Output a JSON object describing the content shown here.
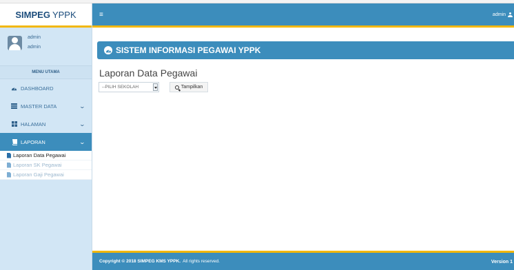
{
  "brand": {
    "bold": "SIMPEG",
    "rest": "YPPK"
  },
  "user_panel": {
    "name": "admin",
    "role": "admin"
  },
  "sidebar": {
    "header": "MENU UTAMA",
    "items": [
      {
        "label": "DASHBOARD",
        "icon": "dashboard-icon"
      },
      {
        "label": "MASTER DATA",
        "icon": "table-icon"
      },
      {
        "label": "HALAMAN",
        "icon": "grid-icon"
      },
      {
        "label": "LAPORAN",
        "icon": "book-icon"
      }
    ],
    "submenu": [
      {
        "label": "Laporan Data Pegawai"
      },
      {
        "label": "Laporan SK Pegawai"
      },
      {
        "label": "Laporan Gaji Pegawai"
      }
    ]
  },
  "navbar": {
    "menu_icon": "≡",
    "user_label": "admin"
  },
  "banner": {
    "title": "SISTEM INFORMASI PEGAWAI YPPK"
  },
  "page": {
    "title": "Laporan Data Pegawai"
  },
  "form": {
    "select_value": "--PILIH SEKOLAH",
    "button_label": "Tampilkan"
  },
  "footer": {
    "copyright_bold": "Copyright © 2018 SIMPEG KMS YPPK.",
    "copyright_rest": "All rights reserved.",
    "version": "Version 1"
  },
  "colors": {
    "primary": "#3c8dbc",
    "accent": "#f2b705",
    "sidebar_bg": "#d2e6f5"
  }
}
